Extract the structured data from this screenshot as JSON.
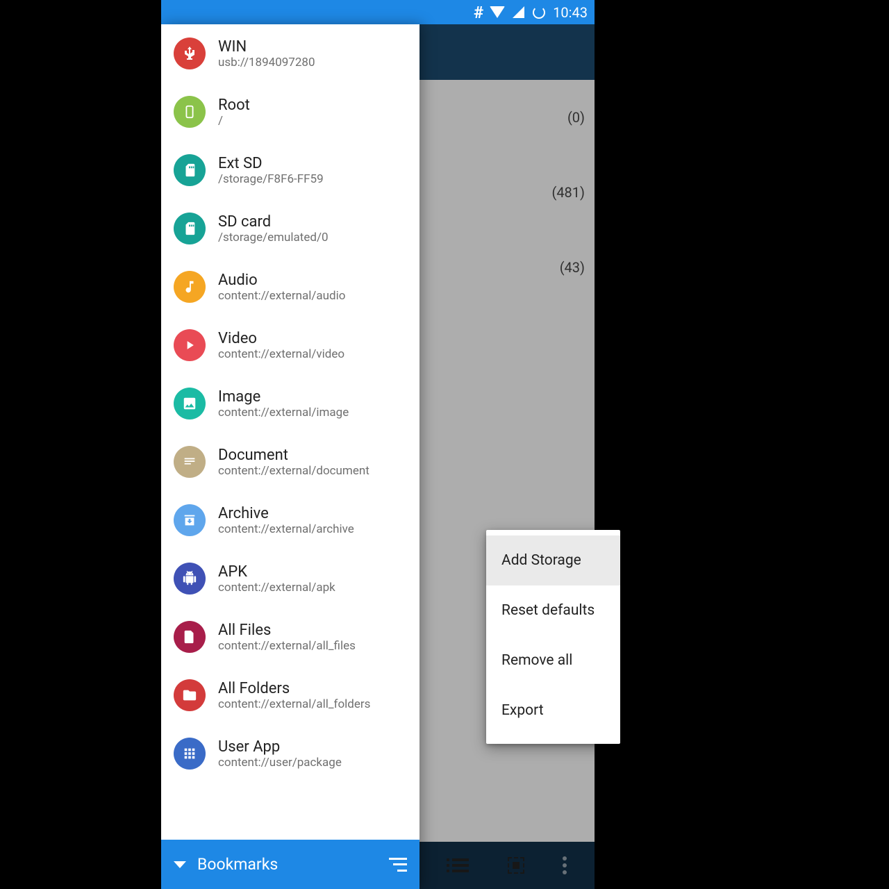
{
  "statusbar": {
    "hash": "#",
    "time": "10:43"
  },
  "background_counts": [
    "(0)",
    "(481)",
    "(43)"
  ],
  "drawer": {
    "bottom_label": "Bookmarks",
    "items": [
      {
        "title": "WIN",
        "sub": "usb://1894097280",
        "color": "#d9403a",
        "icon": "usb"
      },
      {
        "title": "Root",
        "sub": "/",
        "color": "#8bc34a",
        "icon": "phone"
      },
      {
        "title": "Ext SD",
        "sub": "/storage/F8F6-FF59",
        "color": "#17a396",
        "icon": "sd"
      },
      {
        "title": "SD card",
        "sub": "/storage/emulated/0",
        "color": "#17a396",
        "icon": "sd"
      },
      {
        "title": "Audio",
        "sub": "content://external/audio",
        "color": "#f5a623",
        "icon": "note"
      },
      {
        "title": "Video",
        "sub": "content://external/video",
        "color": "#e94b55",
        "icon": "play"
      },
      {
        "title": "Image",
        "sub": "content://external/image",
        "color": "#1bbba4",
        "icon": "image"
      },
      {
        "title": "Document",
        "sub": "content://external/document",
        "color": "#c0ae86",
        "icon": "doc"
      },
      {
        "title": "Archive",
        "sub": "content://external/archive",
        "color": "#5fa6ec",
        "icon": "archive"
      },
      {
        "title": "APK",
        "sub": "content://external/apk",
        "color": "#3f51b5",
        "icon": "android"
      },
      {
        "title": "All Files",
        "sub": "content://external/all_files",
        "color": "#a81e4a",
        "icon": "file"
      },
      {
        "title": "All Folders",
        "sub": "content://external/all_folders",
        "color": "#d33b3b",
        "icon": "folder"
      },
      {
        "title": "User App",
        "sub": "content://user/package",
        "color": "#3a6bc7",
        "icon": "apps"
      }
    ]
  },
  "popup": {
    "items": [
      "Add Storage",
      "Reset defaults",
      "Remove all",
      "Export"
    ],
    "selected_index": 0
  }
}
